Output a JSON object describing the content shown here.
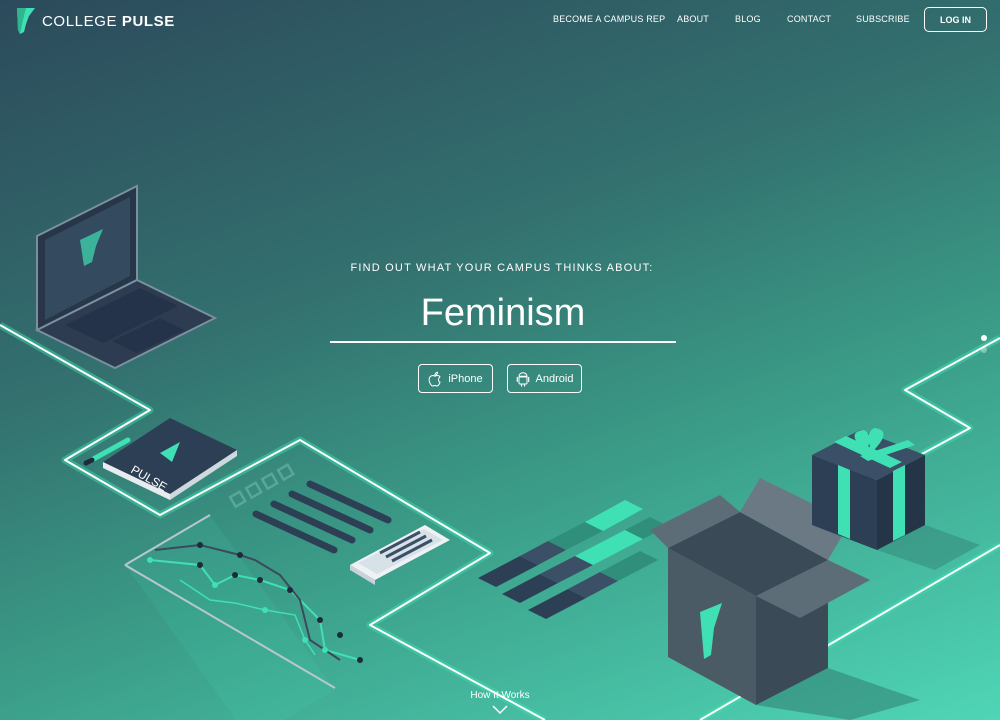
{
  "brand": {
    "name_light": "COLLEGE",
    "name_bold": "PULSE"
  },
  "nav": {
    "items": [
      {
        "label": "BECOME A CAMPUS REP"
      },
      {
        "label": "ABOUT"
      },
      {
        "label": "BLOG"
      },
      {
        "label": "CONTACT"
      },
      {
        "label": "SUBSCRIBE"
      }
    ],
    "login_label": "LOG IN"
  },
  "hero": {
    "subtitle": "FIND OUT WHAT YOUR CAMPUS THINKS ABOUT:",
    "topic": "Feminism",
    "buttons": {
      "iphone": "iPhone",
      "android": "Android"
    }
  },
  "illustration": {
    "notebook_text": "PULSE"
  },
  "carousel": {
    "active_index": 0,
    "count": 2
  },
  "footer": {
    "how_it_works": "How It Works"
  },
  "colors": {
    "accent": "#3fe0b4",
    "dark": "#2d3f55",
    "line": "#ffffff"
  },
  "icons": [
    "logo-icon",
    "apple-icon",
    "android-icon",
    "chevron-down-icon"
  ]
}
